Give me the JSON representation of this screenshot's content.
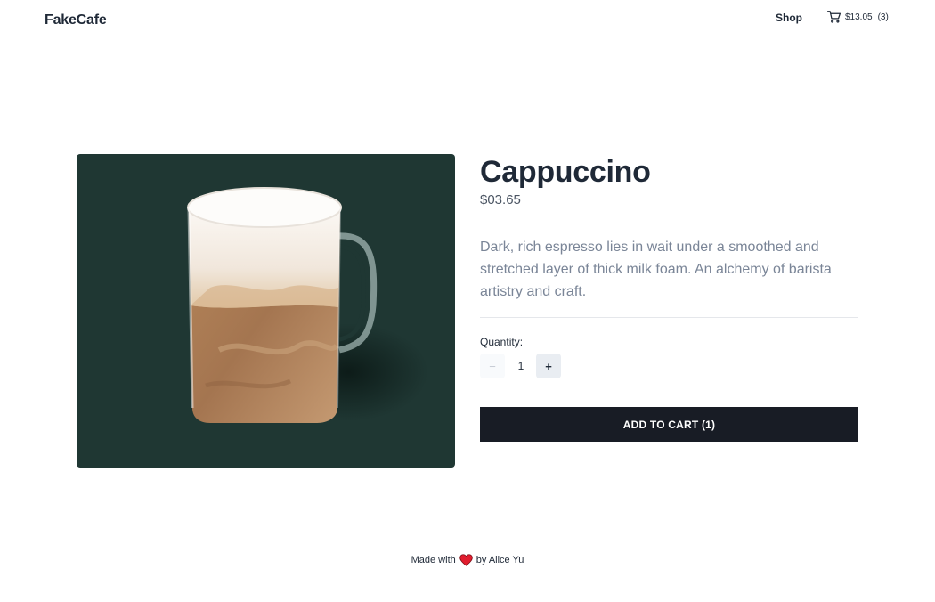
{
  "header": {
    "logo": "FakeCafe",
    "nav_shop": "Shop",
    "cart_total": "$13.05",
    "cart_count": "(3)",
    "cart_icon": "cart-icon"
  },
  "product": {
    "name": "Cappuccino",
    "price": "$03.65",
    "description": "Dark, rich espresso lies in wait under a smoothed and stretched layer of thick milk foam. An alchemy of barista artistry and craft.",
    "image_background": "#1f3733"
  },
  "quantity": {
    "label": "Quantity:",
    "value": "1",
    "minus_symbol": "−",
    "plus_symbol": "+"
  },
  "add_to_cart": {
    "label": "ADD TO CART (1)"
  },
  "footer": {
    "made_with": "Made with",
    "by": "by Alice Yu",
    "heart_icon": "heart-icon",
    "heart_color": "#e11d2e"
  },
  "colors": {
    "primary_button": "#181c25",
    "text": "#1f2937",
    "muted_text": "#7a8597"
  }
}
